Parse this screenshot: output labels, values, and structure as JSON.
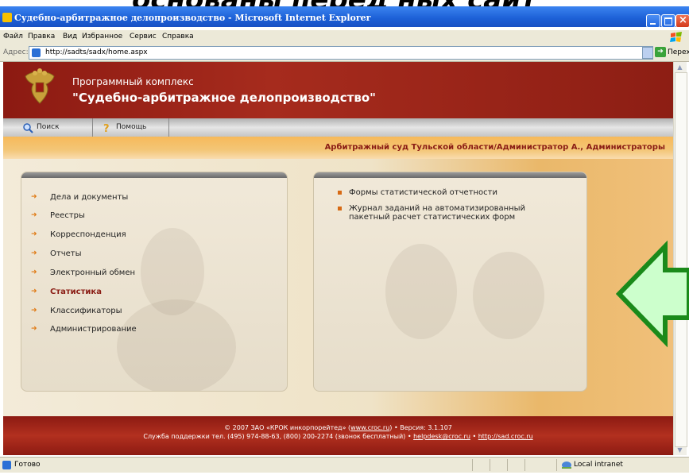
{
  "slide_caption": "основаны перед ных сайт",
  "browser": {
    "title": "Судебно-арбитражное делопроизводство - Microsoft Internet Explorer",
    "menu": [
      "Файл",
      "Правка",
      "Вид",
      "Избранное",
      "Сервис",
      "Справка"
    ],
    "address_label": "Адрес:",
    "url": "http://sadts/sadx/home.aspx",
    "go_label": "Переход",
    "status_text": "Готово",
    "zone": "Local intranet"
  },
  "app": {
    "subtitle": "Программный комплекс",
    "title": "\"Судебно-арбитражное делопроизводство\"",
    "toolbar": {
      "search": "Поиск",
      "help": "Помощь"
    },
    "org_line": "Арбитражный суд Тульской области/Администратор А., Администраторы",
    "nav": [
      {
        "label": "Дела и документы",
        "active": false
      },
      {
        "label": "Реестры",
        "active": false
      },
      {
        "label": "Корреспонденция",
        "active": false
      },
      {
        "label": "Отчеты",
        "active": false
      },
      {
        "label": "Электронный обмен",
        "active": false
      },
      {
        "label": "Статистика",
        "active": true
      },
      {
        "label": "Классификаторы",
        "active": false
      },
      {
        "label": "Администрирование",
        "active": false
      }
    ],
    "right_items": [
      "Формы статистической отчетности",
      "Журнал заданий на автоматизированный пакетный расчет статистических форм"
    ],
    "footer": {
      "line1_pre": "© 2007 ЗАО «КРОК инкорпорейтед» (",
      "line1_link": "www.croc.ru",
      "line1_post": ") • Версия: 3.1.107",
      "line2_pre": "Служба поддержки тел. (495) 974-88-63, (800) 200-2274 (звонок бесплатный) • ",
      "line2_email": "helpdesk@croc.ru",
      "line2_sep": " • ",
      "line2_link": "http://sad.croc.ru"
    }
  },
  "colors": {
    "header_red": "#a62b1d",
    "accent_orange": "#f3c677",
    "arrow_fill": "#ccffcc",
    "arrow_stroke": "#1a8a1a"
  }
}
